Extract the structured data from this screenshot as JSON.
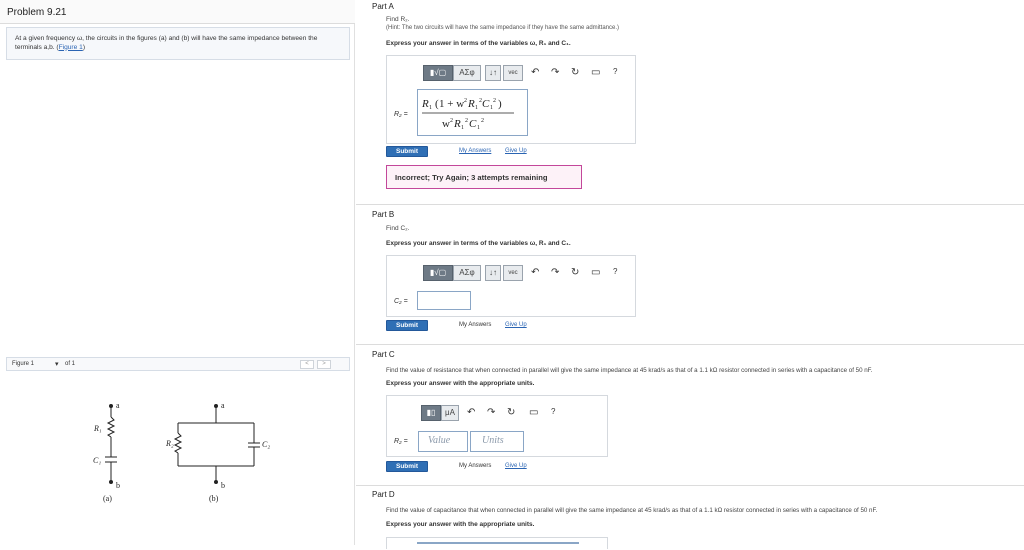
{
  "problem": {
    "title": "Problem 9.21",
    "text": "At a given frequency ω, the circuits in the figures (a) and (b) will have the same impedance between the terminals a,b. (",
    "figure_link": "Figure 1",
    "text_end": ")"
  },
  "figure": {
    "label": "Figure 1",
    "of_text": "of 1",
    "prev": "<",
    "next": ">",
    "labels": {
      "a_top": "a",
      "b_bot": "b",
      "r1": "R₁",
      "c1": "C₁",
      "r2": "R₂",
      "c2": "C₂",
      "cap_a": "(a)",
      "cap_b": "(b)"
    }
  },
  "toolbar": {
    "templates": "▮√▢",
    "greek": "AΣφ",
    "arrows": "↓↑",
    "vec": "vec",
    "undo": "↶",
    "redo": "↷",
    "reset": "↻",
    "keyboard": "▭",
    "help": "?",
    "units_templates": "▮▯",
    "units_mu": "μA"
  },
  "partA": {
    "title": "Part A",
    "prompt": "Find R₂.",
    "hint": "(Hint: The two circuits will have the same impedance if they have the same admittance.)",
    "instruction": "Express your answer in terms of the variables ω, R₁ and C₁.",
    "eq_label": "R₂ =",
    "answer": {
      "num_r": "R",
      "num_rest": "1 + w",
      "den": "w",
      "sup2": "2"
    },
    "submit": "Submit",
    "my_answers": "My Answers",
    "give_up": "Give Up",
    "feedback": "Incorrect; Try Again; 3 attempts remaining"
  },
  "partB": {
    "title": "Part B",
    "prompt": "Find C₂.",
    "instruction": "Express your answer in terms of the variables ω, R₁ and C₁.",
    "eq_label": "C₂ =",
    "submit": "Submit",
    "my_answers": "My Answers",
    "give_up": "Give Up"
  },
  "partC": {
    "title": "Part C",
    "prompt": "Find the value of resistance that when connected in parallel will give the same impedance at 45 krad/s as that of a 1.1 kΩ resistor connected in series with a capacitance of 50 nF.",
    "instruction": "Express your answer with the appropriate units.",
    "eq_label": "R₂ =",
    "value_placeholder": "Value",
    "units_placeholder": "Units",
    "submit": "Submit",
    "my_answers": "My Answers",
    "give_up": "Give Up"
  },
  "partD": {
    "title": "Part D",
    "prompt": "Find the value of capacitance that when connected in parallel will give the same impedance at 45 krad/s as that of a 1.1 kΩ resistor connected in series with a capacitance of 50 nF.",
    "instruction": "Express your answer with the appropriate units."
  },
  "colors": {
    "accent": "#2f6fb5",
    "feedback_border": "#c3479a",
    "link": "#2a64b3"
  }
}
